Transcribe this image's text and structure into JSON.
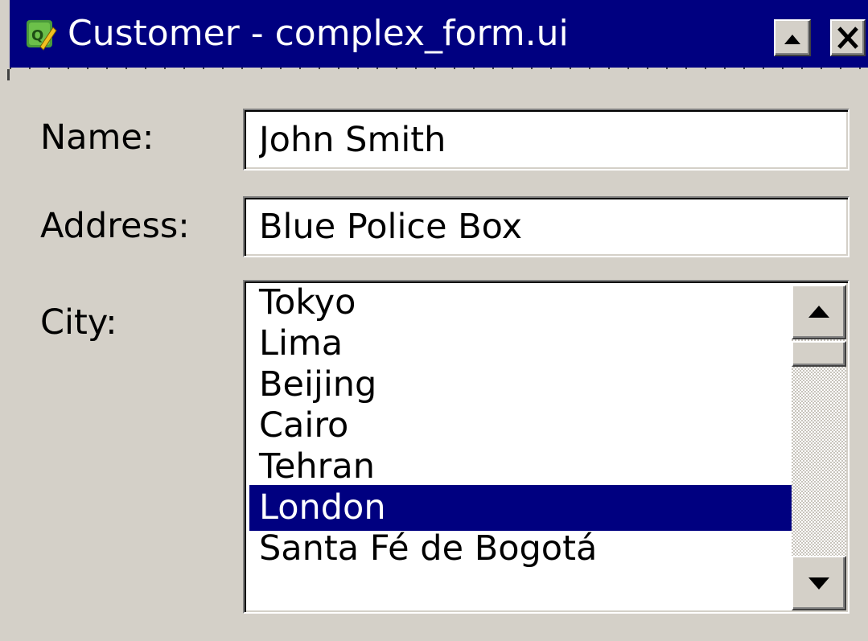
{
  "window": {
    "title": "Customer - complex_form.ui",
    "icon": "qt-designer-icon",
    "buttons": {
      "shade": "shade-up-icon",
      "close": "close-icon"
    }
  },
  "form": {
    "name_label": "Name:",
    "name_value": "John Smith",
    "address_label": "Address:",
    "address_value": "Blue Police Box",
    "city_label": "City:"
  },
  "city_list": {
    "items": [
      "Tokyo",
      "Lima",
      "Beijing",
      "Cairo",
      "Tehran",
      "London",
      "Santa Fé de Bogotá"
    ],
    "selected": "London"
  },
  "colors": {
    "titlebar": "#000080",
    "window_bg": "#d4d0c8",
    "selection": "#000080"
  }
}
